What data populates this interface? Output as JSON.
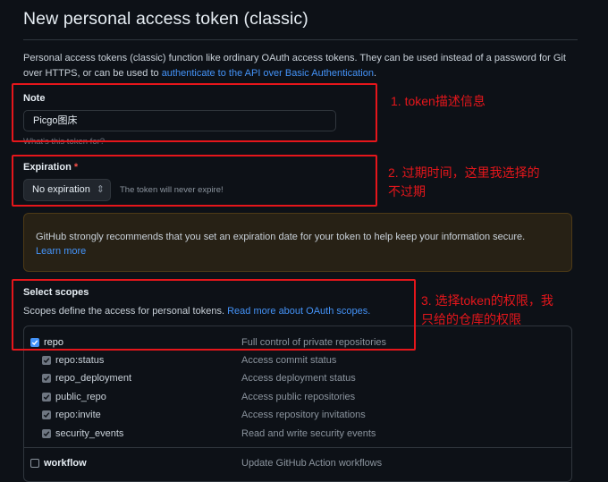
{
  "page": {
    "title": "New personal access token (classic)",
    "intro_text": "Personal access tokens (classic) function like ordinary OAuth access tokens. They can be used instead of a password for Git over HTTPS, or can be used to ",
    "intro_link": "authenticate to the API over Basic Authentication",
    "intro_end": "."
  },
  "note": {
    "label": "Note",
    "value": "Picgo图床",
    "hint": "What's this token for?"
  },
  "expiration": {
    "label": "Expiration",
    "required_mark": "*",
    "selected": "No expiration",
    "hint": "The token will never expire!"
  },
  "warning": {
    "text": "GitHub strongly recommends that you set an expiration date for your token to help keep your information secure.",
    "link": "Learn more"
  },
  "scopes": {
    "heading": "Select scopes",
    "desc_text": "Scopes define the access for personal tokens.",
    "desc_link": "Read more about OAuth scopes.",
    "rows": [
      {
        "name": "repo",
        "desc": "Full control of private repositories",
        "checked": true,
        "child": false
      },
      {
        "name": "repo:status",
        "desc": "Access commit status",
        "checked": true,
        "child": true
      },
      {
        "name": "repo_deployment",
        "desc": "Access deployment status",
        "checked": true,
        "child": true
      },
      {
        "name": "public_repo",
        "desc": "Access public repositories",
        "checked": true,
        "child": true
      },
      {
        "name": "repo:invite",
        "desc": "Access repository invitations",
        "checked": true,
        "child": true
      },
      {
        "name": "security_events",
        "desc": "Read and write security events",
        "checked": true,
        "child": true
      },
      {
        "name": "workflow",
        "desc": "Update GitHub Action workflows",
        "checked": false,
        "child": false
      }
    ]
  },
  "annotations": {
    "a1": "1. token描述信息",
    "a2_line1": "2. 过期时间，这里我选择的",
    "a2_line2": "不过期",
    "a3_line1": "3. 选择token的权限，我",
    "a3_line2": "只给的仓库的权限"
  },
  "colors": {
    "background": "#0d1117",
    "link": "#4493f8",
    "annotation_red": "#e5161b",
    "checkbox_checked": "#4493f8"
  }
}
